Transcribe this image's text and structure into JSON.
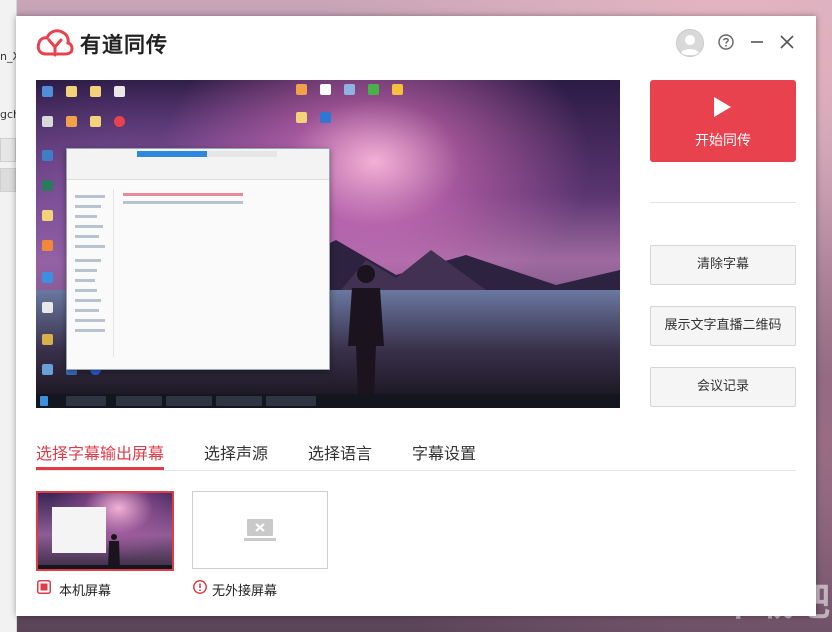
{
  "app": {
    "name": "有道同传",
    "brand_color": "#e8424e"
  },
  "background": {
    "left_fragments": [
      "n_X",
      "gch"
    ],
    "watermark": "下载吧"
  },
  "window_controls": {
    "avatar_icon": "user-avatar-icon",
    "help_icon": "help-circle-icon",
    "minimize_icon": "minimize-icon",
    "close_icon": "close-icon"
  },
  "actions": {
    "start_label": "开始同传",
    "clear_subtitles_label": "清除字幕",
    "show_qr_label": "展示文字直播二维码",
    "meeting_record_label": "会议记录"
  },
  "tabs": [
    {
      "label": "选择字幕输出屏幕",
      "active": true
    },
    {
      "label": "选择声源",
      "active": false
    },
    {
      "label": "选择语言",
      "active": false
    },
    {
      "label": "字幕设置",
      "active": false
    }
  ],
  "screens": [
    {
      "label": "本机屏幕",
      "selected": true,
      "icon": "checkbox-checked-icon"
    },
    {
      "label": "无外接屏幕",
      "selected": false,
      "icon": "warning-circle-icon"
    }
  ]
}
